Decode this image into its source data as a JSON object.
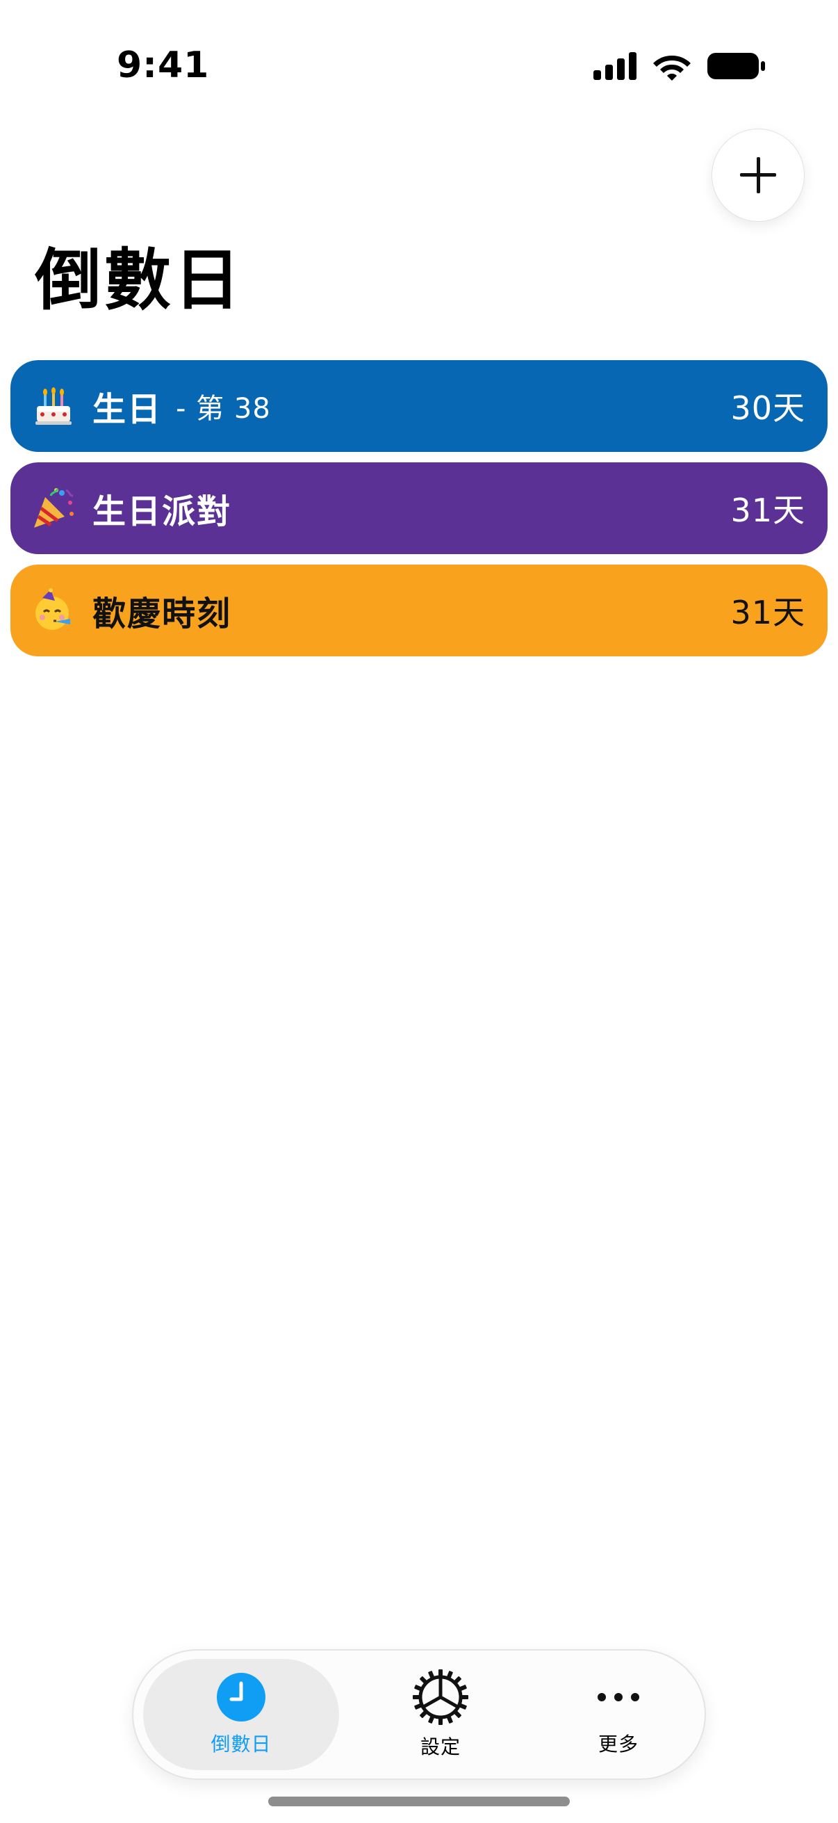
{
  "status_bar": {
    "time": "9:41"
  },
  "header": {
    "title": "倒數日",
    "add_icon": "plus-icon"
  },
  "countdowns": [
    {
      "emoji": "🎂",
      "emoji_icon": "birthday-cake-icon",
      "name": "生日",
      "sub": "- 第 38",
      "days": "30天",
      "color": "#0767b3",
      "text_color": "#ffffff"
    },
    {
      "emoji": "🎉",
      "emoji_icon": "party-popper-icon",
      "name": "生日派對",
      "sub": "",
      "days": "31天",
      "color": "#5b3196",
      "text_color": "#ffffff"
    },
    {
      "emoji": "🥳",
      "emoji_icon": "partying-face-icon",
      "name": "歡慶時刻",
      "sub": "",
      "days": "31天",
      "color": "#f8a21d",
      "text_color": "#111111"
    }
  ],
  "tab_bar": {
    "tabs": [
      {
        "label": "倒數日",
        "icon": "clock-icon",
        "active": true
      },
      {
        "label": "設定",
        "icon": "gear-icon",
        "active": false
      },
      {
        "label": "更多",
        "icon": "more-icon",
        "active": false
      }
    ],
    "accent": "#109ef4"
  }
}
